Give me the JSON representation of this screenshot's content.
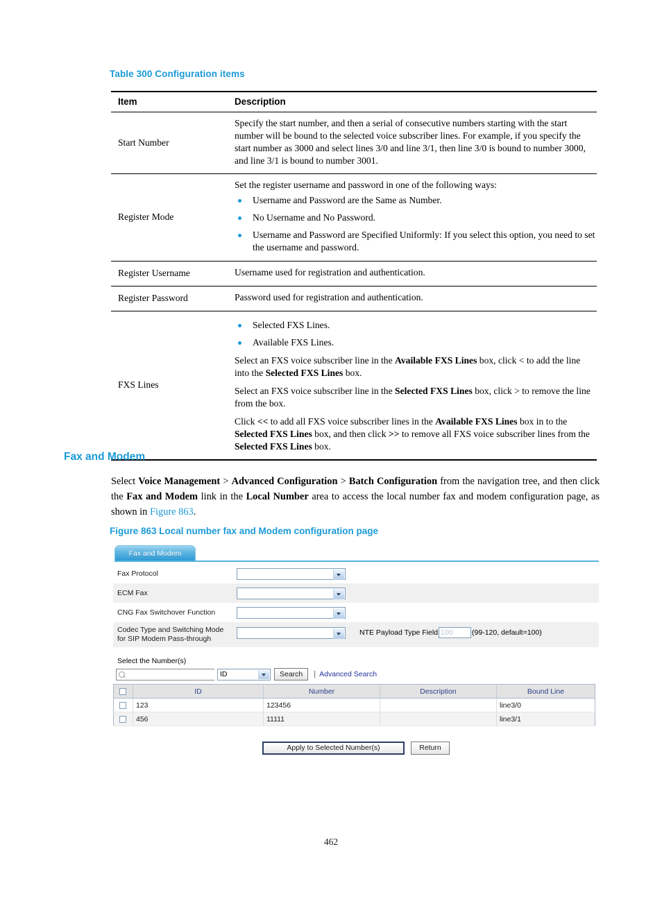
{
  "table": {
    "caption": "Table 300 Configuration items",
    "headers": {
      "item": "Item",
      "description": "Description"
    },
    "rows": [
      {
        "item": "Start Number",
        "paragraphs": [
          "Specify the start number, and then a serial of consecutive numbers starting with the start number will be bound to the selected voice subscriber lines. For example, if you specify the start number as 3000 and select lines 3/0 and line 3/1, then line 3/0 is bound to number 3000, and line 3/1 is bound to number 3001."
        ]
      },
      {
        "item": "Register Mode",
        "intro": "Set the register username and password in one of the following ways:",
        "bullets": [
          "Username and Password are the Same as Number.",
          "No Username and No Password.",
          "Username and Password are Specified Uniformly: If you select this option, you need to set the username and password."
        ]
      },
      {
        "item": "Register Username",
        "paragraphs": [
          "Username used for registration and authentication."
        ]
      },
      {
        "item": "Register Password",
        "paragraphs": [
          "Password used for registration and authentication."
        ]
      },
      {
        "item": "FXS Lines",
        "bullets": [
          "Selected FXS Lines.",
          "Available FXS Lines."
        ]
      }
    ],
    "fxs_paragraph_1_parts": [
      "Select an FXS voice subscriber line in the ",
      "Available FXS Lines",
      " box, click < to add the line into the ",
      "Selected FXS Lines",
      " box."
    ],
    "fxs_paragraph_2_parts": [
      "Select an FXS voice subscriber line in the ",
      "Selected FXS Lines",
      " box, click > to remove the line from the box."
    ],
    "fxs_paragraph_3_parts": [
      "Click ",
      "<<",
      " to add all FXS voice subscriber lines in the ",
      "Available FXS Lines",
      " box in to the ",
      "Selected FXS Lines",
      " box, and then click ",
      ">>",
      " to remove all FXS voice subscriber lines from the ",
      "Selected FXS Lines",
      " box."
    ]
  },
  "section": {
    "heading": "Fax and Modem",
    "paragraph_parts": [
      "Select ",
      "Voice Management",
      " > ",
      "Advanced Configuration",
      " > ",
      "Batch Configuration",
      " from the navigation tree, and then click the ",
      "Fax and Modem",
      " link in the ",
      "Local Number",
      " area to access the local number fax and modem configuration page, as shown in ",
      "Figure 863",
      "."
    ],
    "figure_caption": "Figure 863 Local number fax and Modem configuration page"
  },
  "screenshot": {
    "tab_label": "Fax and Modem",
    "fields": [
      {
        "label": "Fax Protocol",
        "value": ""
      },
      {
        "label": "ECM Fax",
        "value": ""
      },
      {
        "label": "CNG Fax Switchover Function",
        "value": ""
      }
    ],
    "codec_field": {
      "label_line1": "Codec Type and Switching Mode",
      "label_line2": "for SIP Modem Pass-through",
      "value": ""
    },
    "nte": {
      "label": "NTE Payload Type Field",
      "value": "100",
      "hint": "(99-120, default=100)"
    },
    "search": {
      "section_label": "Select the Number(s)",
      "input_value": "",
      "filter_value": "ID",
      "search_button": "Search",
      "advanced_search": "Advanced Search",
      "separator": "|"
    },
    "grid": {
      "columns": [
        "ID",
        "Number",
        "Description",
        "Bound Line"
      ],
      "rows": [
        {
          "id": "123",
          "number": "123456",
          "description": "",
          "bound_line": "line3/0"
        },
        {
          "id": "456",
          "number": "11111",
          "description": "",
          "bound_line": "line3/1"
        }
      ]
    },
    "buttons": {
      "apply": "Apply to Selected Number(s)",
      "return": "Return"
    },
    "colors": {
      "tab_blue": "#2d9ad4",
      "header_link": "#2b3f8c",
      "accent": "#1c9ad6"
    }
  },
  "page_number": "462"
}
